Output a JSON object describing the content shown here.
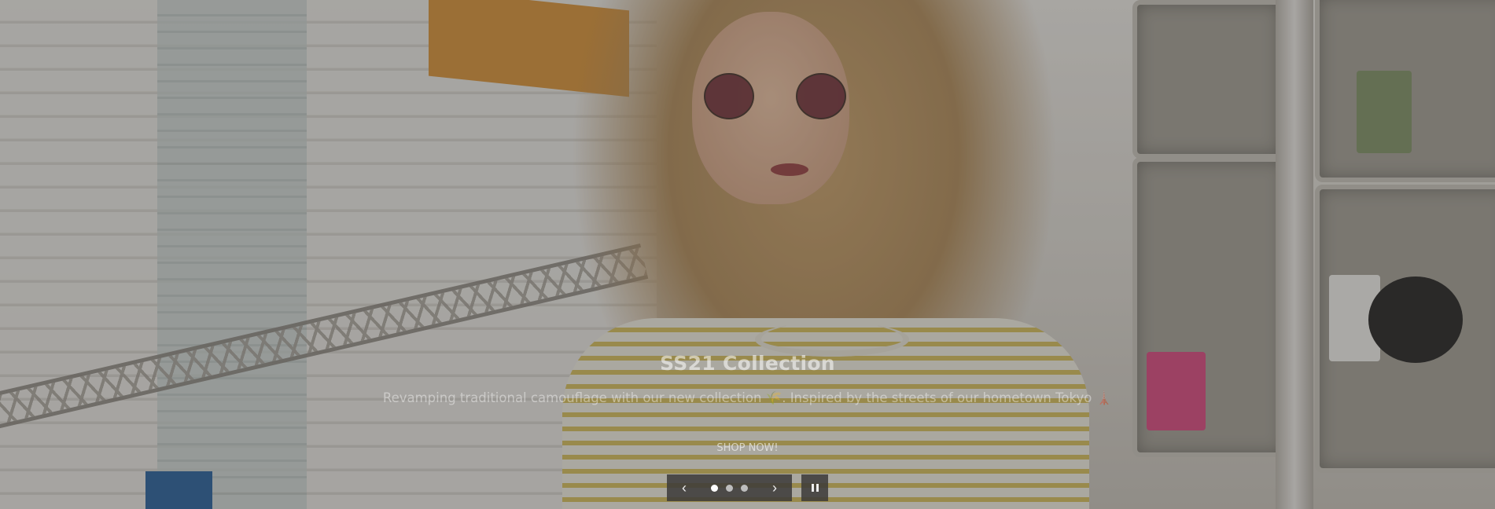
{
  "slide": {
    "title": "SS21 Collection",
    "subtitle": "Revamping traditional camouflage with our new collection 🌾. Inspired by the streets of our hometown Tokyo 🗼",
    "cta_label": "SHOP NOW!"
  },
  "controls": {
    "prev_icon": "chevron-left-icon",
    "next_icon": "chevron-right-icon",
    "pause_icon": "pause-icon",
    "prev_glyph": "‹",
    "next_glyph": "›",
    "slide_count": 3,
    "active_index": 1
  },
  "colors": {
    "overlay": "rgba(0,0,0,0.28)",
    "control_bg": "#3c3a38",
    "dot_active": "#ffffff",
    "dot_inactive": "#bdbdbd"
  }
}
